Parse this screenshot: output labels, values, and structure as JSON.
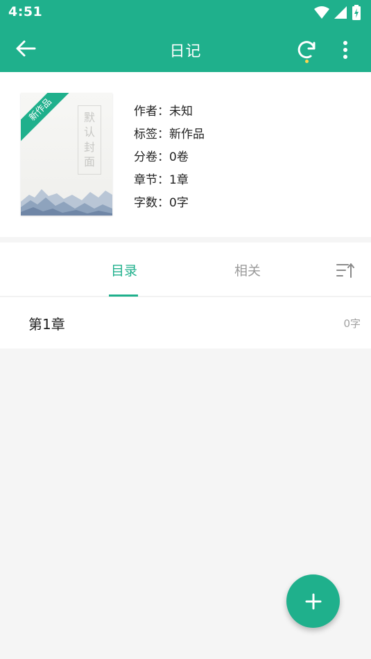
{
  "status_bar": {
    "time": "4:51"
  },
  "app_bar": {
    "title": "日记",
    "back_icon": "arrow-left-icon",
    "sync_icon": "sync-icon",
    "more_icon": "more-vert-icon"
  },
  "book": {
    "cover_ribbon": "新作品",
    "cover_seal": [
      "默",
      "认",
      "封",
      "面"
    ],
    "fields": [
      {
        "key": "作者：",
        "value": "未知"
      },
      {
        "key": "标签：",
        "value": "新作品"
      },
      {
        "key": "分卷：",
        "value": "0卷"
      },
      {
        "key": "章节：",
        "value": "1章"
      },
      {
        "key": "字数：",
        "value": "0字"
      }
    ]
  },
  "tabs": {
    "catalog": "目录",
    "related": "相关",
    "sort_icon": "sort-icon"
  },
  "chapters": [
    {
      "name": "第1章",
      "count": "0字"
    }
  ],
  "fab": {
    "icon": "add-icon"
  },
  "colors": {
    "accent": "#1fb08c",
    "indicator_dot": "#ffd54f"
  }
}
